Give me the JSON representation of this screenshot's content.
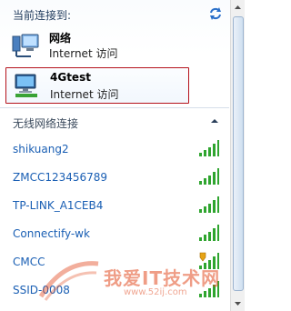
{
  "header": {
    "title": "当前连接到:"
  },
  "connections": [
    {
      "name": "网络",
      "subtitle": "Internet 访问"
    },
    {
      "name": "4Gtest",
      "subtitle": "Internet 访问"
    }
  ],
  "wireless": {
    "section_title": "无线网络连接",
    "networks": [
      {
        "ssid": "shikuang2",
        "secured": false
      },
      {
        "ssid": "ZMCC123456789",
        "secured": false
      },
      {
        "ssid": "TP-LINK_A1CEB4",
        "secured": false
      },
      {
        "ssid": "Connectify-wk",
        "secured": false
      },
      {
        "ssid": "CMCC",
        "secured": true
      },
      {
        "ssid": "SSID-0008",
        "secured": false
      }
    ]
  },
  "watermark": {
    "title": "我爱IT技术网",
    "url": "www.52ij.com"
  },
  "colors": {
    "accent_green": "#2fa52f",
    "link_blue": "#1a5fb4",
    "selection_border": "#b5121b"
  }
}
